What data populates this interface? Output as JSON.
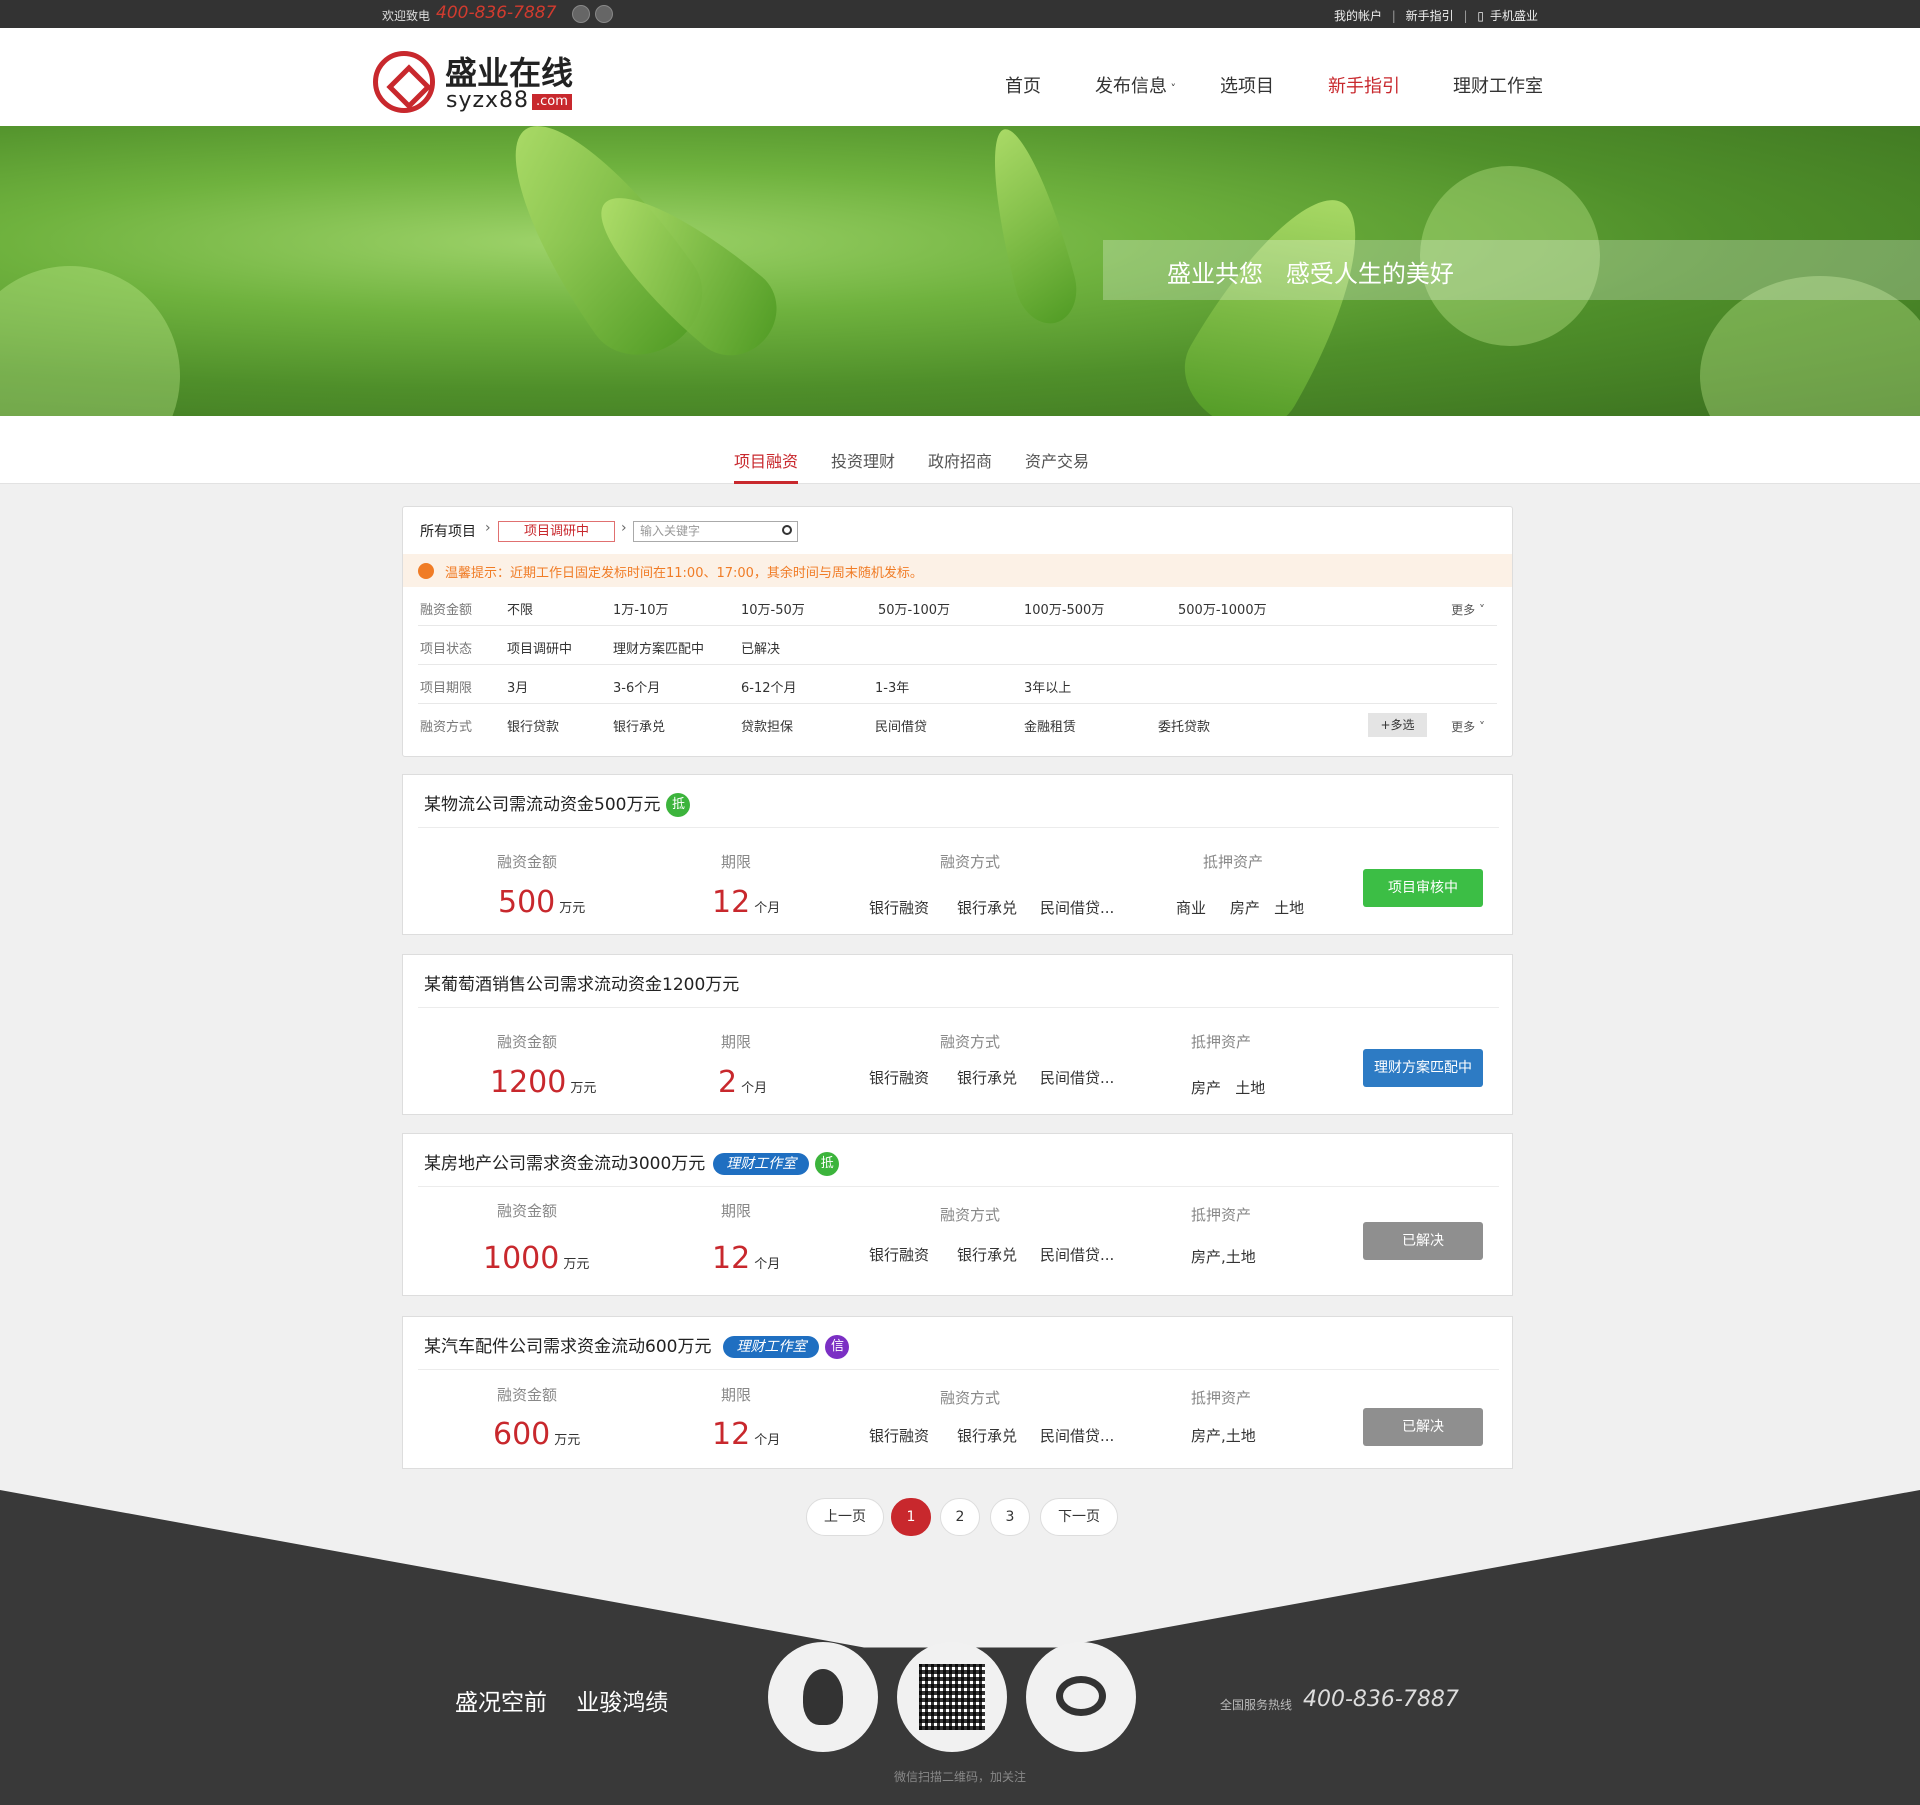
{
  "topbar": {
    "welcome": "欢迎致电",
    "phone": "400-836-7887",
    "links": [
      "我的帐户",
      "新手指引",
      "手机盛业"
    ]
  },
  "logo": {
    "cn": "盛业在线",
    "en": "syzx88",
    "com": ".com"
  },
  "nav": [
    "首页",
    "发布信息",
    "选项目",
    "新手指引",
    "理财工作室"
  ],
  "banner": {
    "slogan": "盛业共您   感受人生的美好"
  },
  "tabs": [
    "项目融资",
    "投资理财",
    "政府招商",
    "资产交易"
  ],
  "filter": {
    "crumb": "所有项目",
    "chip": "项目调研中",
    "search_placeholder": "输入关键字",
    "notice": "温馨提示：近期工作日固定发标时间在11:00、17:00，其余时间与周末随机发标。",
    "more": "更多",
    "multi": "+多选",
    "rows": [
      {
        "label": "融资金额",
        "options": [
          "不限",
          "1万-10万",
          "10万-50万",
          "50万-100万",
          "100万-500万",
          "500万-1000万"
        ]
      },
      {
        "label": "项目状态",
        "options": [
          "项目调研中",
          "理财方案匹配中",
          "已解决"
        ]
      },
      {
        "label": "项目期限",
        "options": [
          "3月",
          "3-6个月",
          "6-12个月",
          "1-3年",
          "3年以上"
        ]
      },
      {
        "label": "融资方式",
        "options": [
          "银行贷款",
          "银行承兑",
          "贷款担保",
          "民间借贷",
          "金融租赁",
          "委托贷款"
        ]
      }
    ]
  },
  "labels": {
    "amount": "融资金额",
    "term": "期限",
    "method": "融资方式",
    "asset": "抵押资产",
    "unit_amount": "万元",
    "unit_term": "个月"
  },
  "projects": [
    {
      "title": "某物流公司需流动资金500万元",
      "pill": "",
      "dot": "抵",
      "dot_color": "#3cb43c",
      "amount": "500",
      "term": "12",
      "methods": [
        "银行融资",
        "银行承兑",
        "民间借贷..."
      ],
      "assets": "商业     房产   土地",
      "button": "项目审核中",
      "button_color": "#3cbe45"
    },
    {
      "title": "某葡萄酒销售公司需求流动资金1200万元",
      "pill": "",
      "dot": "",
      "dot_color": "",
      "amount": "1200",
      "term": "2",
      "methods": [
        "银行融资",
        "银行承兑",
        "民间借贷..."
      ],
      "assets": "房产   土地",
      "button": "理财方案匹配中",
      "button_color": "#2d7bc4"
    },
    {
      "title": "某房地产公司需求资金流动3000万元",
      "pill": "理财工作室",
      "dot": "抵",
      "dot_color": "#3cb43c",
      "amount": "1000",
      "term": "12",
      "methods": [
        "银行融资",
        "银行承兑",
        "民间借贷..."
      ],
      "assets": "房产,土地",
      "button": "已解决",
      "button_color": "#8f8f8f"
    },
    {
      "title": "某汽车配件公司需求资金流动600万元",
      "pill": "理财工作室",
      "dot": "信",
      "dot_color": "#7b2fc4",
      "amount": "600",
      "term": "12",
      "methods": [
        "银行融资",
        "银行承兑",
        "民间借贷..."
      ],
      "assets": "房产,土地",
      "button": "已解决",
      "button_color": "#8f8f8f"
    }
  ],
  "pager": {
    "prev": "上一页",
    "pages": [
      "1",
      "2",
      "3"
    ],
    "next": "下一页",
    "current": "1"
  },
  "footer": {
    "slogan": "盛况空前    业骏鸿绩",
    "hotline_label": "全国服务热线",
    "hotline": "400-836-7887",
    "qr_hint": "微信扫描二维码，加关注"
  }
}
